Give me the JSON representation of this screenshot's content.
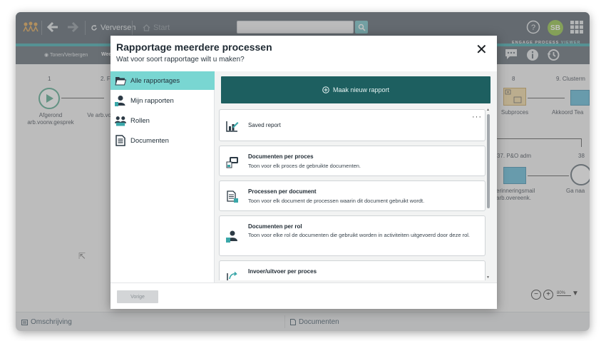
{
  "toolbar": {
    "refresh_label": "Verversen",
    "start_label": "Start",
    "avatar_initials": "SB",
    "show_hide_label": "Tonen/Verbergen",
    "sub_partial": "Wee",
    "brand_name": "ENGAGE PROCESS",
    "brand_suffix": "VIEWER"
  },
  "diagram": {
    "nodes": [
      {
        "num": "1",
        "label": "Afgerond arb.voorw.gesprek"
      },
      {
        "num": "2. F",
        "label": "Ve arb.vo"
      },
      {
        "num": "8",
        "label": "Subproces"
      },
      {
        "num": "9. Clusterm",
        "label": "Akkoord Tea"
      },
      {
        "num": "37. P&O adm",
        "label": "erinneringsmail arb.overeenk."
      },
      {
        "num": "38",
        "label": "Ga naa"
      }
    ],
    "zoom_level": "80%"
  },
  "bottombar": {
    "description_label": "Omschrijving",
    "documents_label": "Documenten"
  },
  "modal": {
    "title": "Rapportage meerdere processen",
    "subtitle": "Wat voor soort rapportage wilt u maken?",
    "categories": [
      {
        "label": "Alle rapportages",
        "icon": "folder-open-icon",
        "active": true
      },
      {
        "label": "Mijn rapporten",
        "icon": "user-icon",
        "active": false
      },
      {
        "label": "Rollen",
        "icon": "users-icon",
        "active": false
      },
      {
        "label": "Documenten",
        "icon": "document-icon",
        "active": false
      }
    ],
    "new_report_label": "Maak nieuw rapport",
    "reports": [
      {
        "title": "Saved report",
        "desc": "",
        "icon": "chart-edit-icon"
      },
      {
        "title": "Documenten per proces",
        "desc": "Toon voor elk proces de gebruikte documenten.",
        "icon": "process-doc-icon"
      },
      {
        "title": "Processen per document",
        "desc": "Toon voor elk document de processen waarin dit document gebruikt wordt.",
        "icon": "doc-process-icon"
      },
      {
        "title": "Documenten per rol",
        "desc": "Toon voor elke rol de documenten die gebruikt worden in activiteiten uitgevoerd door deze rol.",
        "icon": "role-doc-icon"
      },
      {
        "title": "Invoer/uitvoer per proces",
        "desc": "",
        "icon": "input-output-icon"
      }
    ],
    "prev_label": "Vorige"
  },
  "colors": {
    "accent": "#1d5f60",
    "active_category": "#79d6d2",
    "topbar": "#55606b"
  }
}
